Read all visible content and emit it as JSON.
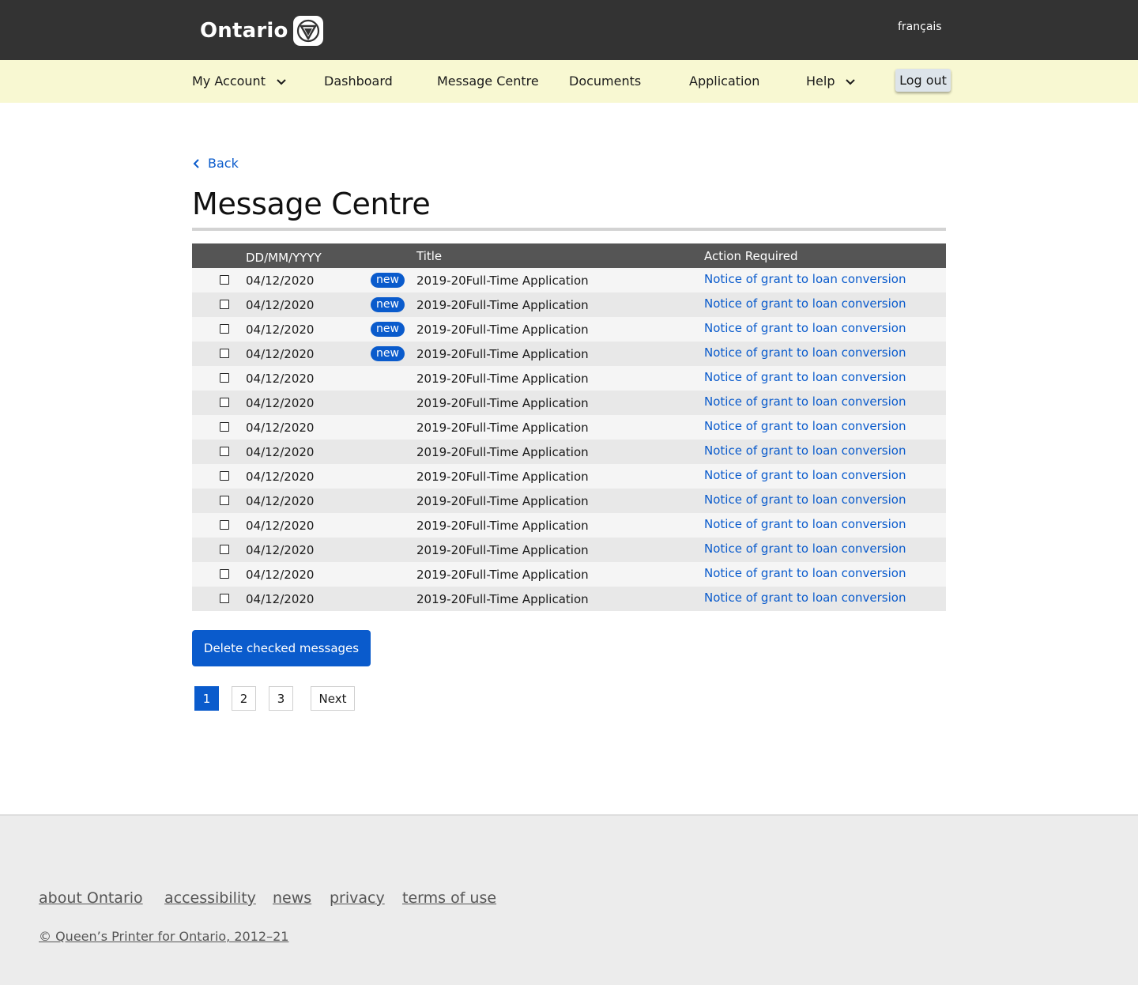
{
  "header": {
    "logo_text": "Ontario",
    "language_link": "français"
  },
  "nav": {
    "my_account": "My Account",
    "dashboard": "Dashboard",
    "message_centre": "Message Centre",
    "documents": "Documents",
    "application": "Application",
    "help": "Help",
    "logout": "Log out"
  },
  "main": {
    "back_label": "Back",
    "title": "Message Centre",
    "table": {
      "col_date": "DD/MM/YYYY",
      "col_title": "Title",
      "col_action": "Action Required",
      "rows": [
        {
          "date": "04/12/2020",
          "badge": "new",
          "title": "2019-20Full-Time Application",
          "action": "Notice of grant to loan conversion"
        },
        {
          "date": "04/12/2020",
          "badge": "new",
          "title": "2019-20Full-Time Application",
          "action": "Notice of grant to loan conversion"
        },
        {
          "date": "04/12/2020",
          "badge": "new",
          "title": "2019-20Full-Time Application",
          "action": "Notice of grant to loan conversion"
        },
        {
          "date": "04/12/2020",
          "badge": "new",
          "title": "2019-20Full-Time Application",
          "action": "Notice of grant to loan conversion"
        },
        {
          "date": "04/12/2020",
          "badge": "",
          "title": "2019-20Full-Time Application",
          "action": "Notice of grant to loan conversion"
        },
        {
          "date": "04/12/2020",
          "badge": "",
          "title": "2019-20Full-Time Application",
          "action": "Notice of grant to loan conversion"
        },
        {
          "date": "04/12/2020",
          "badge": "",
          "title": "2019-20Full-Time Application",
          "action": "Notice of grant to loan conversion"
        },
        {
          "date": "04/12/2020",
          "badge": "",
          "title": "2019-20Full-Time Application",
          "action": "Notice of grant to loan conversion"
        },
        {
          "date": "04/12/2020",
          "badge": "",
          "title": "2019-20Full-Time Application",
          "action": "Notice of grant to loan conversion"
        },
        {
          "date": "04/12/2020",
          "badge": "",
          "title": "2019-20Full-Time Application",
          "action": "Notice of grant to loan conversion"
        },
        {
          "date": "04/12/2020",
          "badge": "",
          "title": "2019-20Full-Time Application",
          "action": "Notice of grant to loan conversion"
        },
        {
          "date": "04/12/2020",
          "badge": "",
          "title": "2019-20Full-Time Application",
          "action": "Notice of grant to loan conversion"
        },
        {
          "date": "04/12/2020",
          "badge": "",
          "title": "2019-20Full-Time Application",
          "action": "Notice of grant to loan conversion"
        },
        {
          "date": "04/12/2020",
          "badge": "",
          "title": "2019-20Full-Time Application",
          "action": "Notice of grant to loan conversion"
        }
      ]
    },
    "delete_button": "Delete checked messages",
    "pagination": {
      "pages": [
        "1",
        "2",
        "3"
      ],
      "current": "1",
      "next": "Next"
    }
  },
  "footer": {
    "links": [
      "about Ontario",
      "accessibility",
      "news",
      "privacy",
      "terms of use"
    ],
    "copyright": "© Queen’s Printer for Ontario, 2012–21"
  },
  "colors": {
    "topbar": "#333333",
    "navbar": "#f8f8d2",
    "accent": "#0a5bcc",
    "table_header": "#555555",
    "footer": "#ececec"
  },
  "icons": {
    "logo_mark": "trillium-icon",
    "nav_dropdown": "chevron-down-icon",
    "back": "chevron-left-icon",
    "row_select": "checkbox"
  }
}
